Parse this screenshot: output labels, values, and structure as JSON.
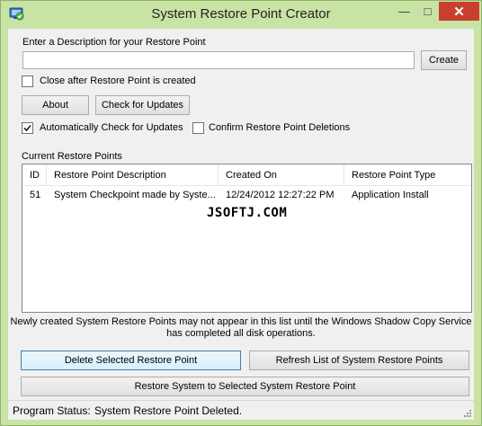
{
  "window": {
    "title": "System Restore Point Creator",
    "icon": "restore-app-icon",
    "controls": {
      "minimize": "—",
      "maximize": "□",
      "close": "✕"
    }
  },
  "description": {
    "label": "Enter a Description for your Restore Point",
    "value": "",
    "create_button": "Create"
  },
  "close_after": {
    "label": "Close after Restore Point is created",
    "checked": false
  },
  "buttons": {
    "about": "About",
    "check_updates": "Check for Updates",
    "delete_selected": "Delete Selected Restore Point",
    "refresh_list": "Refresh List of System Restore Points",
    "restore_system": "Restore System to Selected System Restore Point"
  },
  "options": {
    "auto_check": {
      "label": "Automatically Check for Updates",
      "checked": true
    },
    "confirm_delete": {
      "label": "Confirm Restore Point Deletions",
      "checked": false
    }
  },
  "list": {
    "title": "Current Restore Points",
    "columns": [
      "ID",
      "Restore Point Description",
      "Created On",
      "Restore Point Type"
    ],
    "rows": [
      {
        "id": "51",
        "description": "System Checkpoint made by Syste...",
        "created_on": "12/24/2012 12:27:22 PM",
        "type": "Application Install"
      }
    ]
  },
  "watermark": "JSOFTJ.COM",
  "notice": {
    "line1": "Newly created System Restore Points may not appear in this list until the Windows Shadow Copy Service",
    "line2": "has completed all disk operations."
  },
  "status": {
    "label": "Program Status:",
    "value": "System Restore Point Deleted."
  },
  "colors": {
    "frame": "#c9e3a5",
    "close_button": "#c7402d",
    "focus_border": "#3c7fb1"
  }
}
